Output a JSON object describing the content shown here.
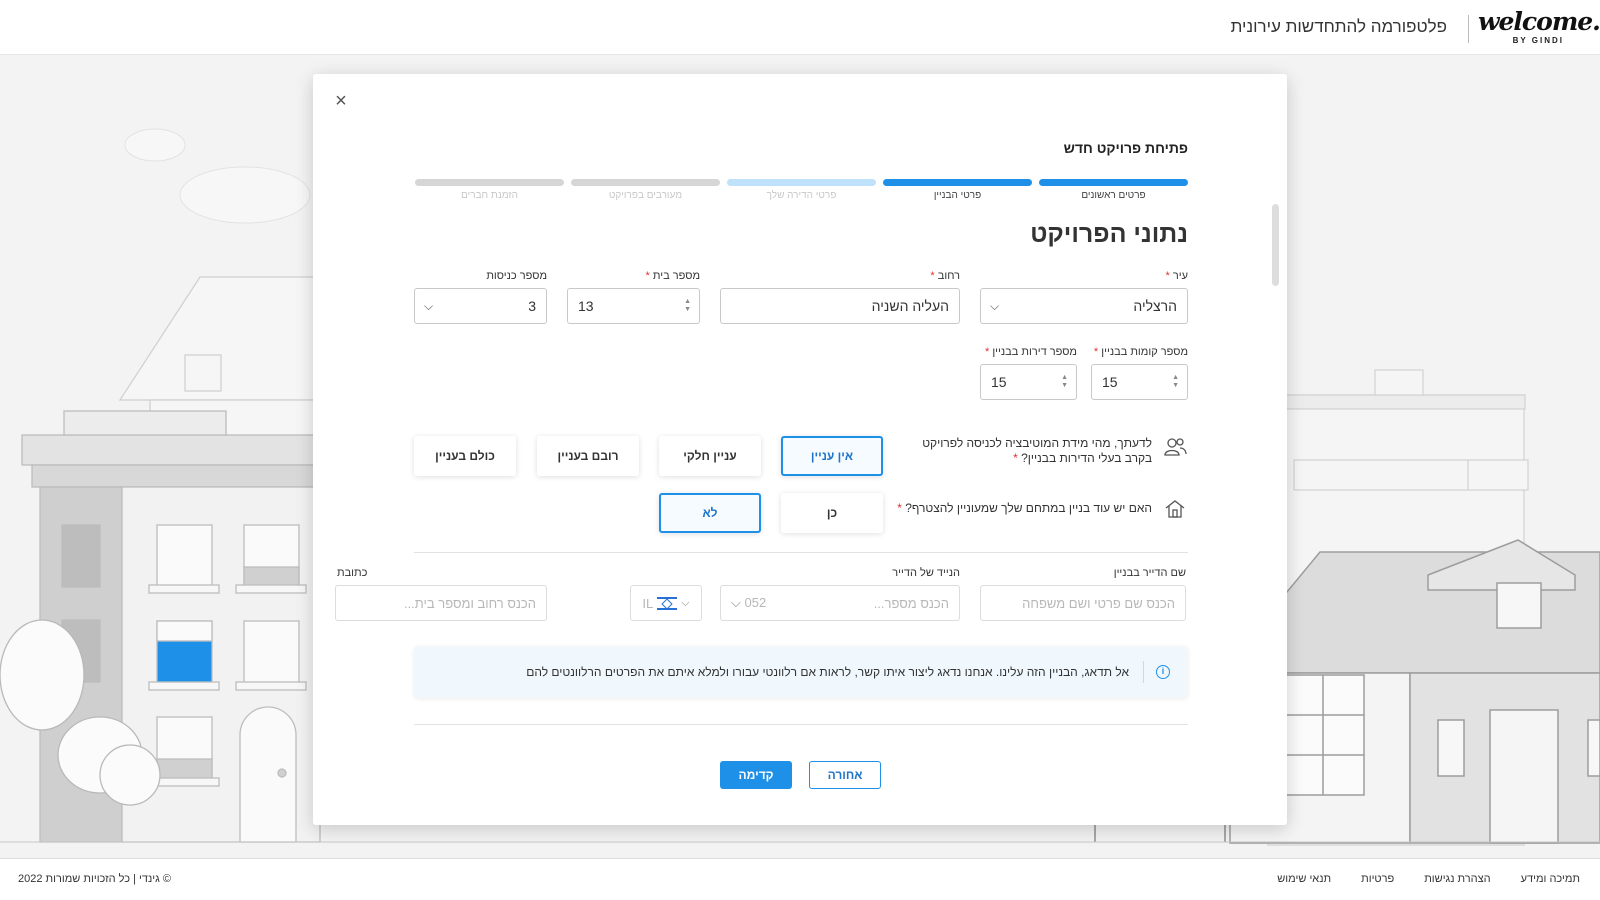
{
  "header": {
    "logo_text": "welcome.",
    "logo_sub": "BY GINDI",
    "tagline": "פלטפורמה להתחדשות עירונית"
  },
  "modal": {
    "close_icon": "close-icon",
    "title": "פתיחת פרויקט חדש",
    "steps": [
      {
        "label": "פרטים ראשונים",
        "state": "done"
      },
      {
        "label": "פרטי הבניין",
        "state": "done"
      },
      {
        "label": "פרטי הדירה שלך",
        "state": "current"
      },
      {
        "label": "מעורבים בפרויקט",
        "state": "pending"
      },
      {
        "label": "הזמנת חברים",
        "state": "pending"
      }
    ],
    "section_title": "נתוני הפרויקט",
    "fields": {
      "city": {
        "label": "עיר",
        "value": "הרצליה"
      },
      "street": {
        "label": "רחוב",
        "value": "העליה השניה"
      },
      "house_number": {
        "label": "מספר בית",
        "value": "13"
      },
      "entrances": {
        "label": "מספר כניסות",
        "value": "3"
      },
      "floors": {
        "label": "מספר קומות בבניין",
        "value": "15"
      },
      "apartments": {
        "label": "מספר דירות בבניין",
        "value": "15"
      }
    },
    "motivation": {
      "question_line1": "לדעתך, מהי מידת המוטיבציה לכניסה לפרויקט",
      "question_line2": "בקרב בעלי הדירות בבניין?",
      "options": [
        "אין עניין",
        "עניין חלקי",
        "רובם בעניין",
        "כולם בעניין"
      ],
      "selected": "אין עניין"
    },
    "other_building": {
      "question": "האם יש עוד בניין במתחם שלך שמעוניין להצטרף?",
      "options": [
        "כן",
        "לא"
      ],
      "selected": "לא"
    },
    "contact": {
      "name_label": "שם הדייר בבניין",
      "name_placeholder": "הכנס שם פרטי ושם משפחה",
      "phone_label": "הנייד של הדייר",
      "phone_placeholder": "הכנס מספר...",
      "phone_prefix": "052",
      "country_code": "IL",
      "address_label": "כתובת",
      "address_placeholder": "הכנס רחוב ומספר בית..."
    },
    "info_text": "אל תדאג, הבניין הזה עלינו. אנחנו נדאג ליצור איתו קשר, לראות אם רלוונטי עבורו ולמלא איתם את הפרטים הרלוונטים להם",
    "buttons": {
      "next": "קדימה",
      "back": "אחורה"
    }
  },
  "footer": {
    "copyright": "© גינדי | כל הזכויות שמורות 2022",
    "links": [
      "תנאי שימוש",
      "פרטיות",
      "הצהרת נגישות",
      "תמיכה ומידע"
    ]
  },
  "colors": {
    "accent": "#1e90e8",
    "required": "#e03030",
    "info_bg": "#f0f8fd"
  }
}
